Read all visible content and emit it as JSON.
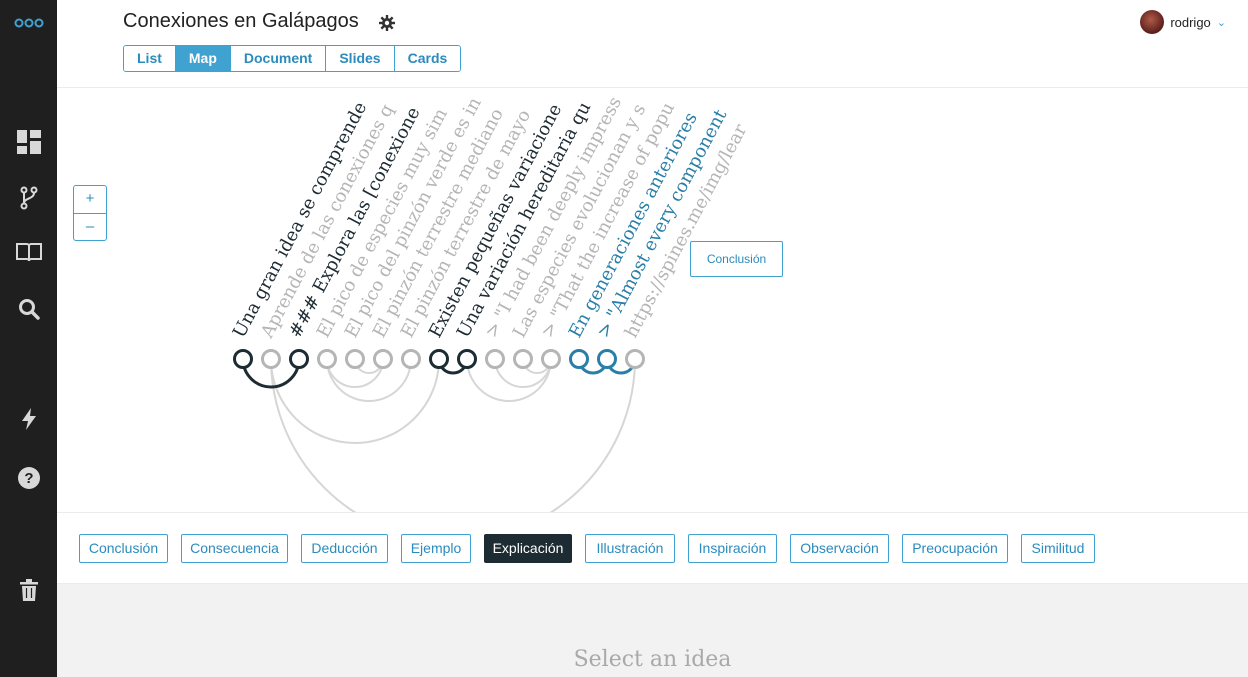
{
  "sidebar": {
    "items": [
      {
        "icon": "logo-icon"
      },
      {
        "icon": "dashboard-icon"
      },
      {
        "icon": "branch-icon"
      },
      {
        "icon": "book-icon"
      },
      {
        "icon": "search-icon"
      },
      {
        "icon": "lightning-icon"
      },
      {
        "icon": "help-icon"
      },
      {
        "icon": "trash-icon"
      }
    ]
  },
  "header": {
    "title": "Conexiones en Galápagos",
    "tabs": [
      {
        "label": "List"
      },
      {
        "label": "Map",
        "active": true
      },
      {
        "label": "Document"
      },
      {
        "label": "Slides"
      },
      {
        "label": "Cards"
      }
    ],
    "user": {
      "name": "rodrigo"
    }
  },
  "map": {
    "zoom_in": "+",
    "zoom_out": "–",
    "conclusion_label": "Conclusión",
    "ideas": [
      {
        "text": "Una gran idea se comprende",
        "color": "#1d2b33"
      },
      {
        "text": "Aprende de las conexiones q",
        "color": "#b5b5b5"
      },
      {
        "text": "### Explora las [conexione",
        "color": "#1d2b33"
      },
      {
        "text": "El pico de especies muy sim",
        "color": "#b5b5b5"
      },
      {
        "text": "El pico del pinzón verde es in",
        "color": "#b5b5b5"
      },
      {
        "text": "El pinzón terrestre mediano",
        "color": "#b5b5b5"
      },
      {
        "text": "El pinzón terrestre de mayo",
        "color": "#b5b5b5"
      },
      {
        "text": "Existen pequeñas variacione",
        "color": "#1d2b33"
      },
      {
        "text": "Una variación hereditaria qu",
        "color": "#1d2b33"
      },
      {
        "text": "> \"I had been deeply impress",
        "color": "#b5b5b5"
      },
      {
        "text": "Las especies evolucionan y s",
        "color": "#b5b5b5"
      },
      {
        "text": "> \"That the increase of popu",
        "color": "#b5b5b5"
      },
      {
        "text": "En generaciones anteriores",
        "color": "#2a7fa8"
      },
      {
        "text": "> \"Almost every component",
        "color": "#2a7fa8"
      },
      {
        "text": "https://spines.me/img/lear",
        "color": "#b5b5b5"
      }
    ],
    "colors": {
      "dark": "#1d2b33",
      "gray": "#b5b5b5",
      "blue": "#2a7fa8",
      "accent": "#3fa2d0"
    }
  },
  "categories": [
    {
      "label": "Conclusión"
    },
    {
      "label": "Consecuencia"
    },
    {
      "label": "Deducción"
    },
    {
      "label": "Ejemplo"
    },
    {
      "label": "Explicación",
      "active": true
    },
    {
      "label": "Illustración"
    },
    {
      "label": "Inspiración"
    },
    {
      "label": "Observación"
    },
    {
      "label": "Preocupación"
    },
    {
      "label": "Similitud"
    }
  ],
  "panel": {
    "placeholder": "Select an idea"
  }
}
